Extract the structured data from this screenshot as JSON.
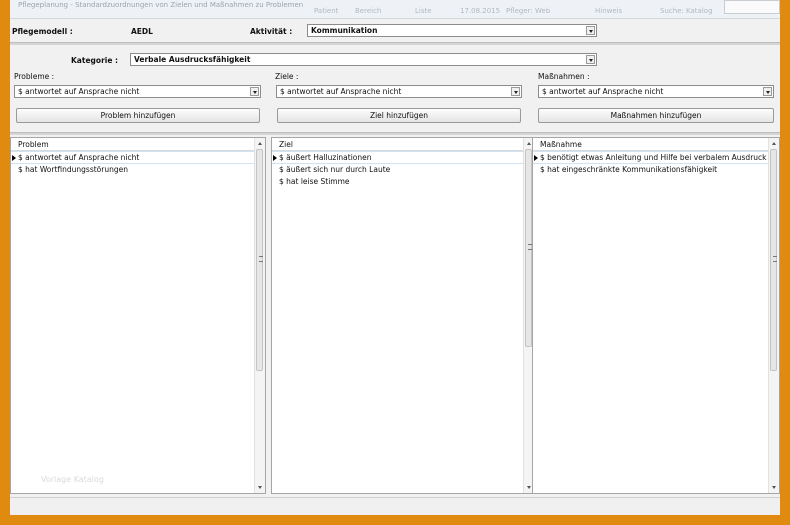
{
  "window": {
    "title": "Pflegeplanung - Standardzuordnungen von Zielen und Maßnahmen zu Problemen",
    "faded_segments": [
      "Patient",
      "Bereich",
      "Liste",
      "17.08.2015",
      "Pfleger: Web",
      "Hinweis",
      "Suche: Katalog"
    ]
  },
  "header": {
    "pflegemodell_label": "Pflegemodell :",
    "pflegemodell_value": "AEDL",
    "aktivitaet_label": "Aktivität :",
    "aktivitaet_value": "Kommunikation",
    "kategorie_label": "Kategorie :",
    "kategorie_value": "Verbale Ausdrucksfähigkeit"
  },
  "selectors": {
    "probleme": {
      "label": "Probleme :",
      "value": "$ antwortet auf Ansprache nicht",
      "button": "Problem hinzufügen"
    },
    "ziele": {
      "label": "Ziele :",
      "value": "$ antwortet auf Ansprache nicht",
      "button": "Ziel hinzufügen"
    },
    "massnahmen": {
      "label": "Maßnahmen :",
      "value": "$ antwortet auf Ansprache nicht",
      "button": "Maßnahmen hinzufügen"
    }
  },
  "lists": {
    "problem": {
      "header": "Problem",
      "items": [
        "$ antwortet auf Ansprache nicht",
        "$ hat Wortfindungsstörungen"
      ]
    },
    "ziel": {
      "header": "Ziel",
      "items": [
        "$ äußert Halluzinationen",
        "$ äußert sich nur durch Laute",
        "$ hat leise Stimme"
      ]
    },
    "massnahme": {
      "header": "Maßnahme",
      "items": [
        "$ benötigt etwas Anleitung und Hilfe bei verbalem Ausdruck",
        "$ hat eingeschränkte Kommunikationsfähigkeit"
      ]
    }
  },
  "watermark": "Vorlage Katalog",
  "icons": {
    "arrow": "chevron-down-icon",
    "row_pointer": "row-pointer-icon"
  },
  "colors": {
    "frame": "#e08a10",
    "selection_border": "#cfe3f5"
  }
}
